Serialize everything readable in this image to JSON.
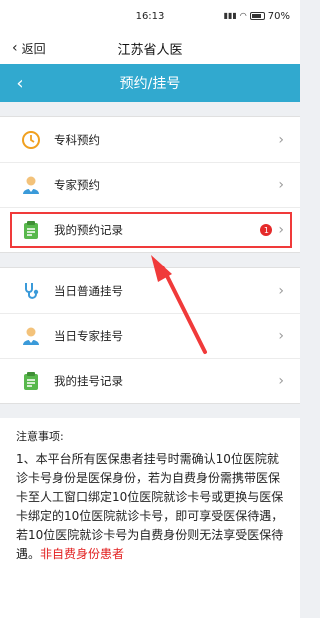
{
  "status": {
    "time": "16:13",
    "battery": "70%"
  },
  "appbar": {
    "back_label": "返回",
    "title": "江苏省人医"
  },
  "subbar": {
    "title": "预约/挂号"
  },
  "group1": [
    {
      "label": "专科预约",
      "icon": "clock-icon"
    },
    {
      "label": "专家预约",
      "icon": "doctor-icon"
    },
    {
      "label": "我的预约记录",
      "icon": "record-icon",
      "badge": "1"
    }
  ],
  "group2": [
    {
      "label": "当日普通挂号",
      "icon": "stethoscope-icon"
    },
    {
      "label": "当日专家挂号",
      "icon": "doctor-icon"
    },
    {
      "label": "我的挂号记录",
      "icon": "record-icon"
    }
  ],
  "notice": {
    "title": "注意事项:",
    "body": "1、本平台所有医保患者挂号时需确认10位医院就诊卡号身份是医保身份，若为自费身份需携带医保卡至人工窗口绑定10位医院就诊卡号或更换与医保卡绑定的10位医院就诊卡号，即可享受医保待遇，若10位医院就诊卡号为自费身份则无法享受医保待遇。",
    "red": "非自费身份患者"
  },
  "colors": {
    "accent": "#31a9cf",
    "highlight": "#f03a3a"
  }
}
